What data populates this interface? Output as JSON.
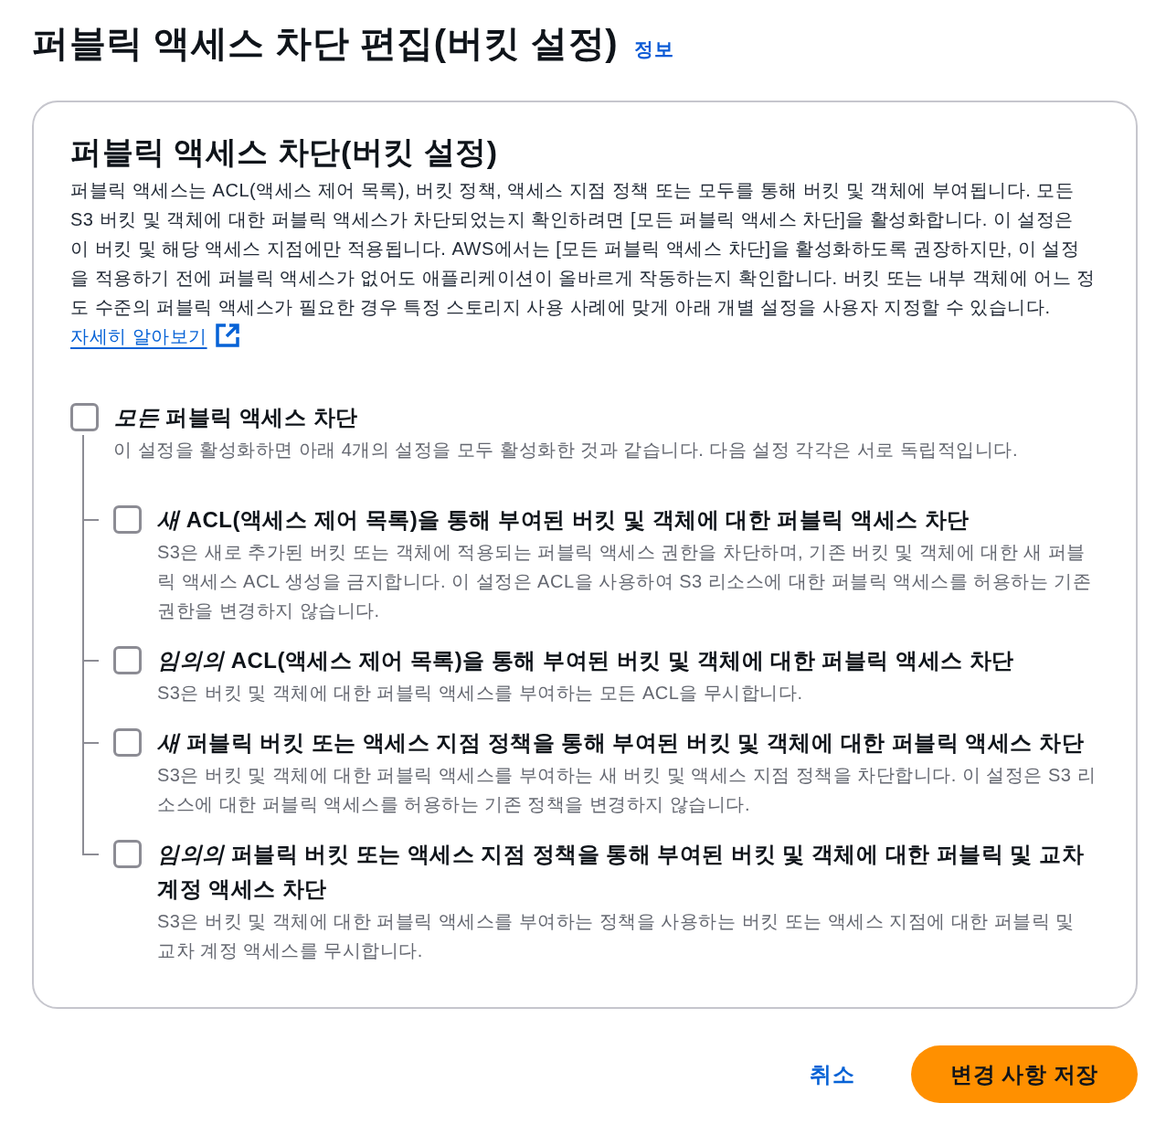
{
  "page": {
    "title": "퍼블릭 액세스 차단 편집(버킷 설정)",
    "info_link": "정보"
  },
  "panel": {
    "title": "퍼블릭 액세스 차단(버킷 설정)",
    "description": "퍼블릭 액세스는 ACL(액세스 제어 목록), 버킷 정책, 액세스 지점 정책 또는 모두를 통해 버킷 및 객체에 부여됩니다. 모든 S3 버킷 및 객체에 대한 퍼블릭 액세스가 차단되었는지 확인하려면 [모든 퍼블릭 액세스 차단]을 활성화합니다. 이 설정은 이 버킷 및 해당 액세스 지점에만 적용됩니다. AWS에서는 [모든 퍼블릭 액세스 차단]을 활성화하도록 권장하지만, 이 설정을 적용하기 전에 퍼블릭 액세스가 없어도 애플리케이션이 올바르게 작동하는지 확인합니다. 버킷 또는 내부 객체에 어느 정도 수준의 퍼블릭 액세스가 필요한 경우 특정 스토리지 사용 사례에 맞게 아래 개별 설정을 사용자 지정할 수 있습니다.",
    "learn_more_link": "자세히 알아보기",
    "block_all": {
      "label": "*모든* 퍼블릭 액세스 차단",
      "description": "이 설정을 활성화하면 아래 4개의 설정을 모두 활성화한 것과 같습니다. 다음 설정 각각은 서로 독립적입니다.",
      "checked": false,
      "children": [
        {
          "label": "*새* ACL(액세스 제어 목록)을 통해 부여된 버킷 및 객체에 대한 퍼블릭 액세스 차단",
          "description": "S3은 새로 추가된 버킷 또는 객체에 적용되는 퍼블릭 액세스 권한을 차단하며, 기존 버킷 및 객체에 대한 새 퍼블릭 액세스 ACL 생성을 금지합니다. 이 설정은 ACL을 사용하여 S3 리소스에 대한 퍼블릭 액세스를 허용하는 기존 권한을 변경하지 않습니다.",
          "checked": false
        },
        {
          "label": "*임의의* ACL(액세스 제어 목록)을 통해 부여된 버킷 및 객체에 대한 퍼블릭 액세스 차단",
          "description": "S3은 버킷 및 객체에 대한 퍼블릭 액세스를 부여하는 모든 ACL을 무시합니다.",
          "checked": false
        },
        {
          "label": "*새* 퍼블릭 버킷 또는 액세스 지점 정책을 통해 부여된 버킷 및 객체에 대한 퍼블릭 액세스 차단",
          "description": "S3은 버킷 및 객체에 대한 퍼블릭 액세스를 부여하는 새 버킷 및 액세스 지점 정책을 차단합니다. 이 설정은 S3 리소스에 대한 퍼블릭 액세스를 허용하는 기존 정책을 변경하지 않습니다.",
          "checked": false
        },
        {
          "label": "*임의의* 퍼블릭 버킷 또는 액세스 지점 정책을 통해 부여된 버킷 및 객체에 대한 퍼블릭 및 교차 계정 액세스 차단",
          "description": "S3은 버킷 및 객체에 대한 퍼블릭 액세스를 부여하는 정책을 사용하는 버킷 또는 액세스 지점에 대한 퍼블릭 및 교차 계정 액세스를 무시합니다.",
          "checked": false
        }
      ]
    }
  },
  "buttons": [
    {
      "label": "취소",
      "kind": "link"
    },
    {
      "label": "변경 사항 저장",
      "kind": "primary"
    }
  ]
}
